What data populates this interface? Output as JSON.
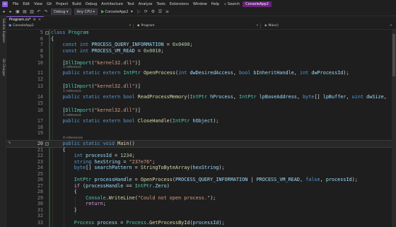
{
  "menu": {
    "items": [
      "File",
      "Edit",
      "View",
      "Git",
      "Project",
      "Build",
      "Debug",
      "Test",
      "Analyze",
      "Tools",
      "Extensions",
      "Window",
      "Help"
    ],
    "architecture": "Architecture",
    "search_label": "Search",
    "project_name": "ConsoleApp2"
  },
  "toolbar": {
    "config": "Debug",
    "platform": "Any CPU",
    "run_target": "ConsoleApp2"
  },
  "side": {
    "label1": "Solution Explorer",
    "label2": "Git Changes"
  },
  "tabs": {
    "active": "Program.cs*",
    "project": "ConsoleApp2"
  },
  "navbar": {
    "project": "ConsoleApp2",
    "class_path": "Program",
    "member": "Main()"
  },
  "editor": {
    "lines": [
      {
        "n": "5",
        "text": "class Program",
        "class_name": "Program"
      },
      {
        "n": "6",
        "text": "{"
      },
      {
        "n": "7",
        "text": "    const int PROCESS_QUERY_INFORMATION = 0x0400;"
      },
      {
        "n": "8",
        "text": "    const int PROCESS_VM_READ = 0x0010;"
      },
      {
        "n": "9",
        "text": ""
      },
      {
        "n": "10",
        "text": "    [DllImport(\"kernel32.dll\")]"
      },
      {
        "n": "11",
        "text": "    public static extern IntPtr OpenProcess(int dwDesiredAccess, bool bInheritHandle, int dwProcessId);",
        "lens": "1 reference"
      },
      {
        "n": "12",
        "text": ""
      },
      {
        "n": "13",
        "text": "    [DllImport(\"kernel32.dll\")]"
      },
      {
        "n": "14",
        "text": "    public static extern bool ReadProcessMemory(IntPtr hProcess, IntPtr lpBaseAddress, byte[] lpBuffer, uint dwSize,",
        "lens": "1 reference"
      },
      {
        "n": "15",
        "text": ""
      },
      {
        "n": "16",
        "text": "    [DllImport(\"kernel32.dll\")]"
      },
      {
        "n": "17",
        "text": "    public static extern bool CloseHandle(IntPtr hObject);",
        "lens": "1 reference"
      },
      {
        "n": "18",
        "text": ""
      },
      {
        "n": "19",
        "text": ""
      },
      {
        "n": "20",
        "text": "    public static void Main()",
        "lens": "0 references"
      },
      {
        "n": "21",
        "text": "    {"
      },
      {
        "n": "22",
        "text": "        int processId = 1234;"
      },
      {
        "n": "23",
        "text": "        string hexString = \"237e76\";"
      },
      {
        "n": "24",
        "text": "        byte[] searchPattern = StringToByteArray(hexString);"
      },
      {
        "n": "25",
        "text": ""
      },
      {
        "n": "26",
        "text": "        IntPtr processHandle = OpenProcess(PROCESS_QUERY_INFORMATION | PROCESS_VM_READ, false, processId);"
      },
      {
        "n": "27",
        "text": "        if (processHandle == IntPtr.Zero)"
      },
      {
        "n": "28",
        "text": "        {"
      },
      {
        "n": "29",
        "text": "            Console.WriteLine(\"Could not open process.\");"
      },
      {
        "n": "30",
        "text": "            return;"
      },
      {
        "n": "31",
        "text": "        }"
      },
      {
        "n": "32",
        "text": ""
      },
      {
        "n": "33",
        "text": "        Process process = Process.GetProcessById(processId);"
      }
    ],
    "current_line": "20"
  },
  "colors": {
    "accent": "#68217a",
    "keyword": "#569cd6",
    "type": "#4ec9b0",
    "string": "#d69d85",
    "number": "#b5cea8",
    "method": "#dcdcaa"
  }
}
